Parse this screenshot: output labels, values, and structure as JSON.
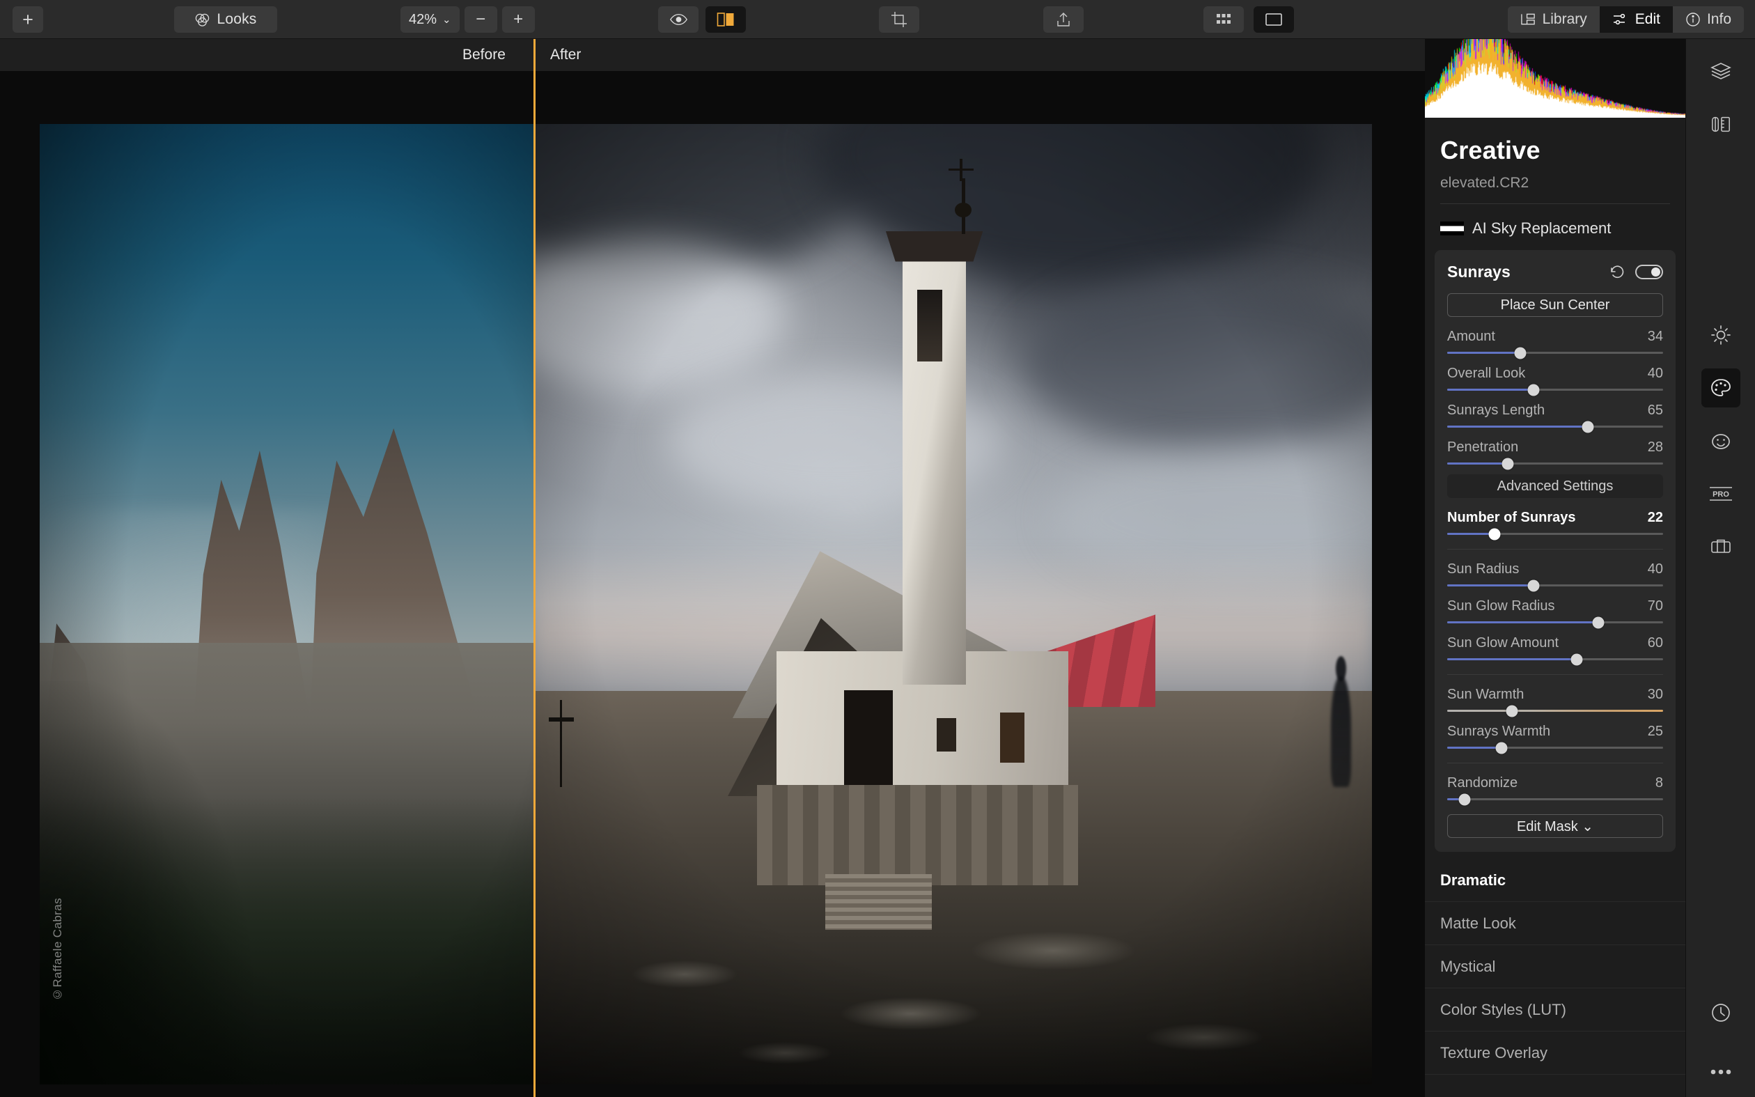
{
  "toolbar": {
    "add_label": "+",
    "looks_label": "Looks",
    "looks_icon": "venn-circles-icon",
    "zoom_value": "42%",
    "zoom_caret": "⌄",
    "zoom_out_label": "−",
    "zoom_in_label": "+",
    "eye_icon": "preview-eye-icon",
    "compare_icon": "before-after-split-icon",
    "crop_icon": "crop-icon",
    "share_icon": "share-export-icon",
    "grid_icon": "grid-view-icon",
    "fullscreen_icon": "single-view-icon",
    "tabs": [
      {
        "label": "Library",
        "icon": "library-icon",
        "selected": false
      },
      {
        "label": "Edit",
        "icon": "sliders-icon",
        "selected": true
      },
      {
        "label": "Info",
        "icon": "info-circle-icon",
        "selected": false
      }
    ]
  },
  "compare": {
    "before_label": "Before",
    "after_label": "After",
    "divider_color": "#f0a93a"
  },
  "canvas": {
    "watermark": "©Raffaele Cabras"
  },
  "panel": {
    "title": "Creative",
    "filename": "elevated.CR2",
    "sky_replacement": {
      "label": "AI Sky Replacement",
      "swatch_icon": "sky-gradient-swatch-icon"
    },
    "sunrays": {
      "name": "Sunrays",
      "reset_icon": "reset-arrow-icon",
      "toggle_icon": "toggle-on-icon",
      "toggle_on": true,
      "place_sun_center_label": "Place Sun Center",
      "advanced_settings_label": "Advanced Settings",
      "edit_mask_label": "Edit Mask ⌄",
      "sliders_group_1": [
        {
          "label": "Amount",
          "value": 34,
          "min": 0,
          "max": 100,
          "track": "blue",
          "highlight": false
        },
        {
          "label": "Overall Look",
          "value": 40,
          "min": 0,
          "max": 100,
          "track": "blue",
          "highlight": false
        },
        {
          "label": "Sunrays Length",
          "value": 65,
          "min": 0,
          "max": 100,
          "track": "blue",
          "highlight": false
        },
        {
          "label": "Penetration",
          "value": 28,
          "min": 0,
          "max": 100,
          "track": "blue",
          "highlight": false
        }
      ],
      "sliders_group_2": [
        {
          "label": "Number of Sunrays",
          "value": 22,
          "min": 0,
          "max": 100,
          "track": "blue",
          "highlight": true
        }
      ],
      "sliders_group_3": [
        {
          "label": "Sun Radius",
          "value": 40,
          "min": 0,
          "max": 100,
          "track": "blue",
          "highlight": false
        },
        {
          "label": "Sun Glow Radius",
          "value": 70,
          "min": 0,
          "max": 100,
          "track": "blue",
          "highlight": false
        },
        {
          "label": "Sun Glow Amount",
          "value": 60,
          "min": 0,
          "max": 100,
          "track": "blue",
          "highlight": false
        }
      ],
      "sliders_group_4": [
        {
          "label": "Sun Warmth",
          "value": 30,
          "min": 0,
          "max": 100,
          "track": "warm",
          "highlight": false
        },
        {
          "label": "Sunrays Warmth",
          "value": 25,
          "min": 0,
          "max": 100,
          "track": "blue",
          "highlight": false
        }
      ],
      "sliders_group_5": [
        {
          "label": "Randomize",
          "value": 8,
          "min": 0,
          "max": 100,
          "track": "blue",
          "highlight": false
        }
      ]
    },
    "tools": [
      {
        "label": "Dramatic",
        "selected": true
      },
      {
        "label": "Matte Look",
        "selected": false
      },
      {
        "label": "Mystical",
        "selected": false
      },
      {
        "label": "Color Styles (LUT)",
        "selected": false
      },
      {
        "label": "Texture Overlay",
        "selected": false
      }
    ]
  },
  "rail": {
    "icons": [
      {
        "name": "layers-icon",
        "selected": false
      },
      {
        "name": "tools-ruler-icon",
        "selected": false
      },
      {
        "name": "essentials-sun-icon",
        "selected": false
      },
      {
        "name": "creative-palette-icon",
        "selected": true
      },
      {
        "name": "portrait-face-icon",
        "selected": false
      },
      {
        "name": "pro-icon",
        "selected": false
      },
      {
        "name": "toolkit-case-icon",
        "selected": false
      },
      {
        "name": "history-clock-icon",
        "selected": false
      },
      {
        "name": "more-dots-icon",
        "selected": false
      }
    ]
  },
  "colors": {
    "accent": "#f0a93a",
    "slider_fill": "#6173c4",
    "panel_bg": "#1d1d1d",
    "toolbar_bg": "#2b2b2b"
  }
}
